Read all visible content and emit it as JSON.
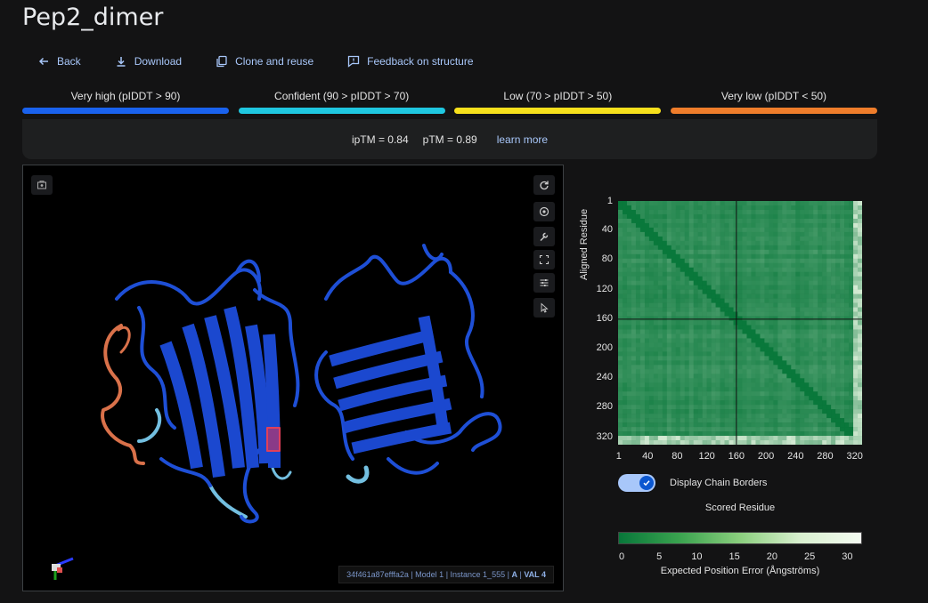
{
  "title": "Pep2_dimer",
  "actions": {
    "back": "Back",
    "download": "Download",
    "clone": "Clone and reuse",
    "feedback": "Feedback on structure"
  },
  "confidence_legend": [
    {
      "label": "Very high (pIDDT > 90)",
      "color": "#1a62ee"
    },
    {
      "label": "Confident (90 > pIDDT > 70)",
      "color": "#1fc7e0"
    },
    {
      "label": "Low (70 > pIDDT > 50)",
      "color": "#f7e01c"
    },
    {
      "label": "Very low (pIDDT < 50)",
      "color": "#ef7d2b"
    }
  ],
  "metrics": {
    "iptm": "ipTM = 0.84",
    "ptm": "pTM = 0.89",
    "learn_more": "learn more"
  },
  "viewer": {
    "status_id": "34f461a87efffa2a | Model 1 | Instance 1_555 |",
    "status_chain": "A",
    "status_sep": "|",
    "status_residue": "VAL 4"
  },
  "pae": {
    "ylabel": "Aligned Residue",
    "yticks": [
      "1",
      "40",
      "80",
      "120",
      "160",
      "200",
      "240",
      "280",
      "320"
    ],
    "xticks": [
      "1",
      "40",
      "80",
      "120",
      "160",
      "200",
      "240",
      "280",
      "320"
    ],
    "toggle_label": "Display Chain Borders",
    "toggle_on": true,
    "xlabel": "Scored Residue",
    "scale_ticks": [
      "0",
      "5",
      "10",
      "15",
      "20",
      "25",
      "30"
    ],
    "scale_title": "Expected Position Error (Ångströms)",
    "chain_border": 160,
    "max_residue": 330
  }
}
